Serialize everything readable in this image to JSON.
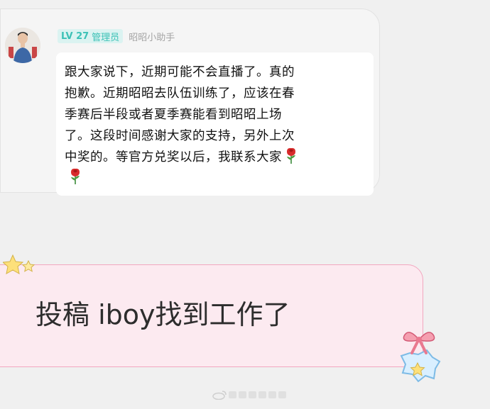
{
  "chat": {
    "badge_level": "LV 27",
    "badge_role": "管理员",
    "sender_name": "昭昭小助手",
    "message_lines": [
      "跟大家说下，近期可能不会直播了。真的",
      "抱歉。近期昭昭去队伍训练了，应该在春",
      "季赛后半段或者夏季赛能看到昭昭上场",
      "了。这段时间感谢大家的支持，另外上次",
      "中奖的。等官方兑奖以后，我联系大家"
    ],
    "emoji": "rose"
  },
  "post": {
    "text": "投稿 iboy找到工作了"
  },
  "colors": {
    "badge_bg": "#dbf3f1",
    "badge_text": "#3cc1b6",
    "post_bg": "#fceaf0",
    "post_border": "#f2a7bf"
  },
  "icons": [
    "avatar-photo",
    "rose-emoji",
    "star-decoration",
    "ribbon-bow-sticker",
    "weibo-watermark"
  ]
}
